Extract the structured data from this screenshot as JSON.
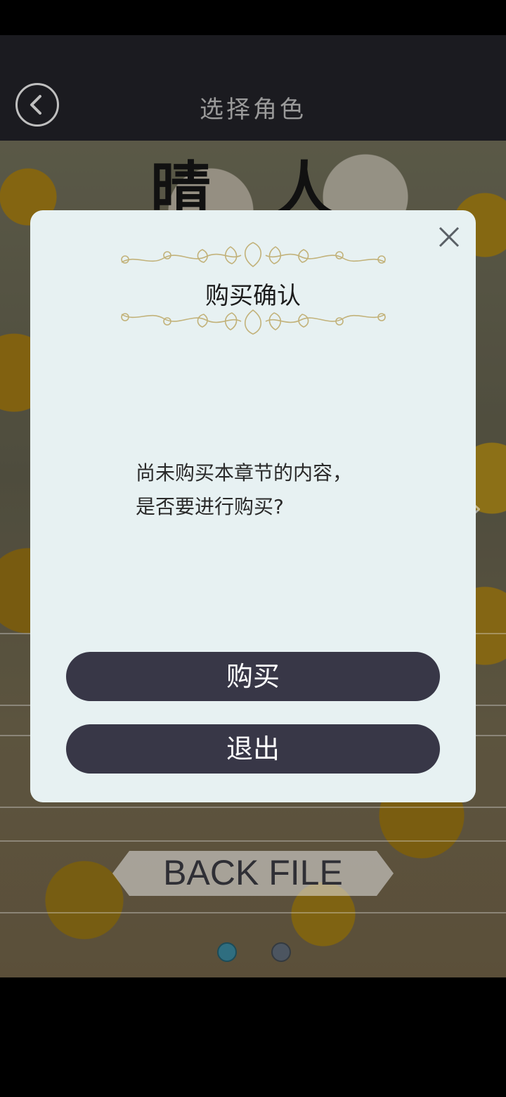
{
  "header": {
    "title": "选择角色",
    "back_icon": "chevron-left-icon"
  },
  "scene": {
    "character_name": "晴 人",
    "back_file_label": "BACK FILE",
    "carousel": {
      "pages": 2,
      "active_page": 1
    },
    "colors": {
      "active_dot": "#2f6e80",
      "inactive_dot": "#4c5560"
    }
  },
  "dialog": {
    "title": "购买确认",
    "message_line1": "尚未购买本章节的内容，",
    "message_line2": "是否要进行购买?",
    "buy_label": "购买",
    "exit_label": "退出",
    "close_icon": "close-icon",
    "colors": {
      "background": "#e7f1f2",
      "button": "#383747",
      "ornament": "#c2b27a"
    }
  }
}
